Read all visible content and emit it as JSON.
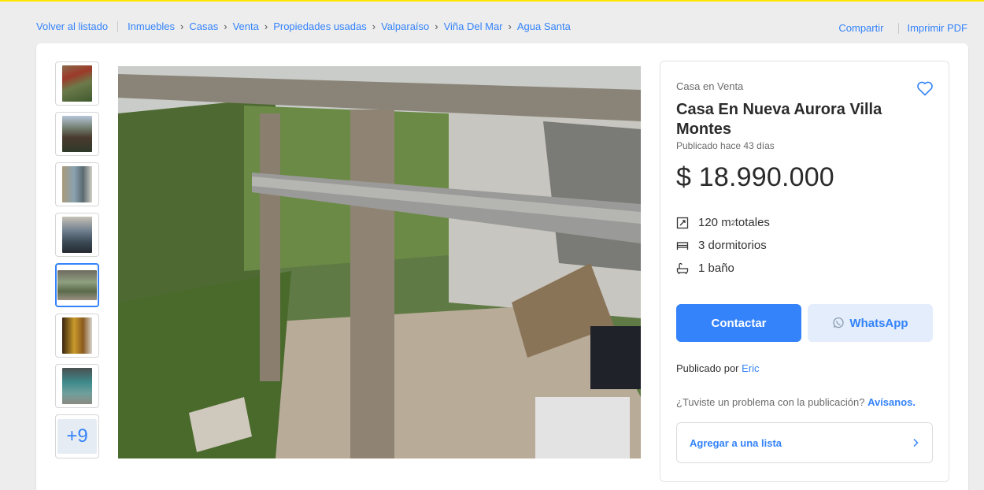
{
  "breadcrumb": {
    "back_label": "Volver al listado",
    "crumbs": [
      "Inmuebles",
      "Casas",
      "Venta",
      "Propiedades usadas",
      "Valparaíso",
      "Viña Del Mar",
      "Agua Santa"
    ]
  },
  "top_actions": {
    "share_label": "Compartir",
    "print_label": "Imprimir PDF"
  },
  "gallery": {
    "thumbnails": [
      {
        "icon": "house-photo"
      },
      {
        "icon": "house-photo"
      },
      {
        "icon": "house-photo"
      },
      {
        "icon": "house-photo"
      },
      {
        "icon": "house-photo",
        "selected": true
      },
      {
        "icon": "house-photo"
      },
      {
        "icon": "house-photo"
      }
    ],
    "more_label": "+9",
    "main_photo_icon": "porch-photo"
  },
  "listing": {
    "subtitle": "Casa en Venta",
    "title": "Casa En Nueva Aurora Villa Montes",
    "published": "Publicado hace 43 días",
    "price": "$ 18.990.000",
    "features": {
      "area_number": "120 m",
      "area_sup": "2",
      "area_suffix": " totales",
      "bedrooms": "3 dormitorios",
      "bathrooms": "1 baño"
    },
    "contact_label": "Contactar",
    "whatsapp_label": "WhatsApp",
    "published_by_prefix": "Publicado por",
    "seller_name": "Eric",
    "problem_text": "¿Tuviste un problema con la publicación?",
    "problem_link": "Avísanos.",
    "add_list_label": "Agregar a una lista"
  },
  "colors": {
    "accent": "#3483fa",
    "topbar": "#ffe600",
    "background": "#ededed"
  }
}
